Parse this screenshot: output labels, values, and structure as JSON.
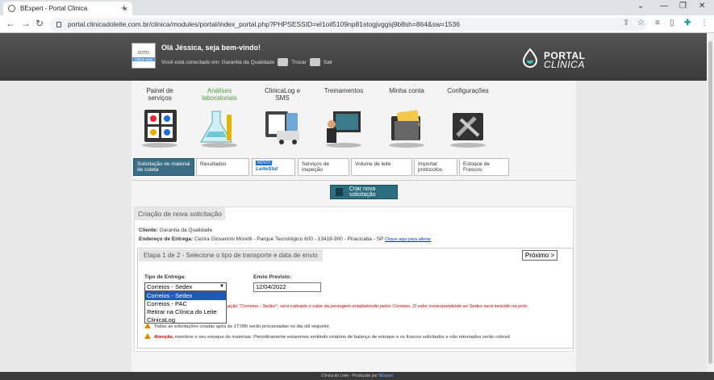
{
  "browser": {
    "tab_title": "BExpert - Portal Clínica",
    "url": "portal.clinicadoleite.com.br/clinica/modules/portal/index_portal.php?PHPSESSID=el1oil5109np81stogjvggsj9b8sh=864&sw=1536",
    "new_tab": "+",
    "close_tab": "×"
  },
  "header": {
    "photo_label": "FOTO",
    "photo_link": "Clique aqui",
    "welcome": "Olá Jéssica, seja bem-vindo!",
    "connected_to": "Você está conectado em: Garantia da Qualidade",
    "switch_label": "Trocar",
    "logout_label": "Sair",
    "logo_line1": "PORTAL",
    "logo_line2": "CLÍNICA"
  },
  "main_menu": [
    {
      "label": "Painel de serviços",
      "active": false
    },
    {
      "label": "Análises laboratoriais",
      "active": true
    },
    {
      "label": "ClinicaLog e SMS",
      "active": false
    },
    {
      "label": "Treinamentos",
      "active": false
    },
    {
      "label": "Minha conta",
      "active": false
    },
    {
      "label": "Configurações",
      "active": false
    }
  ],
  "sub_menu": [
    {
      "label": "Solicitação de material de coleta",
      "active": true
    },
    {
      "label": "Resultados",
      "active": false
    },
    {
      "label": "LeiteStat",
      "badge": "NOVO!",
      "active": false
    },
    {
      "label": "Serviços de inspeção",
      "active": false
    },
    {
      "label": "Volume de leite",
      "active": false
    },
    {
      "label": "Importar protocolos",
      "active": false
    },
    {
      "label": "Estoque de Frascos",
      "active": false
    }
  ],
  "create_button": "Criar nova solicitação",
  "panel": {
    "title": "Criação de nova solicitação",
    "client_label": "Cliente:",
    "client_value": "Garantia da Qualidade",
    "address_label": "Endereço de Entrega:",
    "address_value": "Cezira Giovanoni Moretti - Parque Tecnológico  600 - 13418-900 - Piracicaba - SP",
    "address_link": "Clique aqui para alterar"
  },
  "step": {
    "title": "Etapa 1 de 2 - Selecione o tipo de transporte e data de envio",
    "next_button": "Próximo >",
    "delivery_label": "Tipo de Entrega:",
    "delivery_selected": "Correios - Sedex",
    "delivery_options": [
      "Correios - Sedex",
      "Correios - PAC",
      "Retirar na Clínica do Leite",
      "ClinicaLog"
    ],
    "date_label": "Envio Previsto:",
    "date_value": "12/04/2022",
    "warning_red": "pção \"Correios - Sedex\", será cobrado o valor da postagem estabelecido pelos Correios. O valor correspondente ao Sedex será incluído na próx",
    "warning_time": "Todas as solicitações criadas após às 17:00h serão processadas no dia útil seguinte.",
    "attention_label": "Atenção,",
    "attention_text": " monitore o seu estoque de materiais. Periodicamente estaremos emitindo relatório de balanço de estoque e os frascos solicitados e não retornados serão cobrad"
  },
  "footer": {
    "text": "Clínica do Leite - Produzido por ",
    "link": "BExpert"
  }
}
